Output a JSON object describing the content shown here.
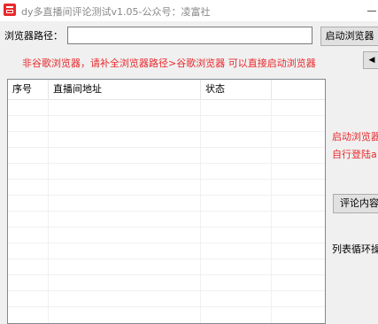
{
  "window": {
    "title": "dy多直播间评论测试v1.05-公众号：凌富社",
    "minimize_symbol": ""
  },
  "browser_path": {
    "label": "浏览器路径：",
    "value": "",
    "launch_button": "启动浏览器"
  },
  "nav_arrow": "◀",
  "warning": "非谷歌浏览器，请补全浏览器路径>谷歌浏览器  可以直接启动浏览器",
  "list": {
    "columns": [
      "序号",
      "直播间地址",
      "状态",
      ""
    ],
    "rows": []
  },
  "side_panel": {
    "launch_hint": "启动浏览器",
    "login_hint": "自行登陆a",
    "comment_button": "评论内容",
    "loop_text": "列表循环操"
  },
  "colors": {
    "accent_red": "#e8292c",
    "window_bg": "#f0f0f0"
  }
}
